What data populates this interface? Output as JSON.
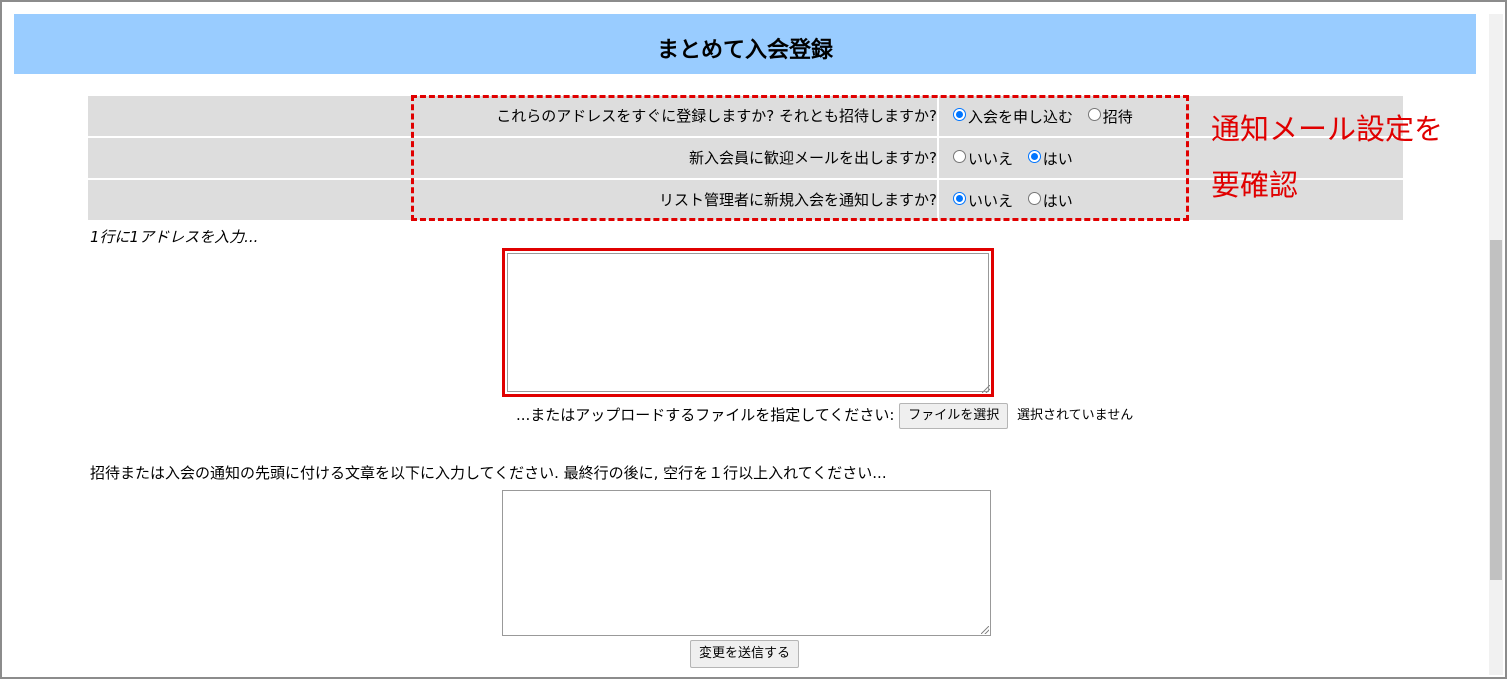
{
  "header": {
    "title": "まとめて入会登録"
  },
  "options": [
    {
      "question": "これらのアドレスをすぐに登録しますか? それとも招待しますか?",
      "choices": [
        {
          "label": "入会を申し込む",
          "selected": true
        },
        {
          "label": "招待",
          "selected": false
        }
      ]
    },
    {
      "question": "新入会員に歓迎メールを出しますか?",
      "choices": [
        {
          "label": "いいえ",
          "selected": false
        },
        {
          "label": "はい",
          "selected": true
        }
      ]
    },
    {
      "question": "リスト管理者に新規入会を通知しますか?",
      "choices": [
        {
          "label": "いいえ",
          "selected": true
        },
        {
          "label": "はい",
          "selected": false
        }
      ]
    }
  ],
  "annotation": {
    "line1": "通知メール設定を",
    "line2": "要確認",
    "color": "#e00000"
  },
  "address_entry": {
    "hint": "1行に1アドレスを入力...",
    "value": ""
  },
  "upload": {
    "label": "...またはアップロードするファイルを指定してください:",
    "button_label": "ファイルを選択",
    "status": "選択されていません"
  },
  "invite_text": {
    "label": "招待または入会の通知の先頭に付ける文章を以下に入力してください. 最終行の後に, 空行を１行以上入れてください...",
    "value": ""
  },
  "submit": {
    "label": "変更を送信する"
  },
  "colors": {
    "header_bg": "#99ccff",
    "row_bg": "#dddddd",
    "radio_selected": "#0075ff"
  }
}
